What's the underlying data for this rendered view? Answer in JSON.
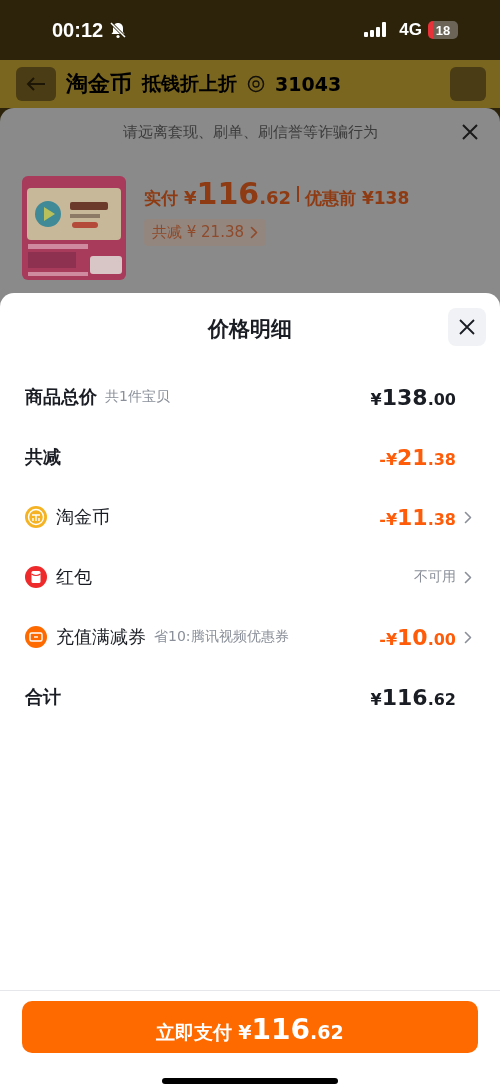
{
  "status_bar": {
    "time": "00:12",
    "network": "4G",
    "battery": "18"
  },
  "backdrop": {
    "header": {
      "title": "淘金币",
      "subtitle": "抵钱折上折",
      "coins": "31043"
    },
    "notice": "请远离套现、刷单、刷信誉等诈骗行为",
    "product": {
      "kind": "picture",
      "paid_label": "实付",
      "paid_price": "¥116.62",
      "original_price": "优惠前 ¥138",
      "discount_chip": "共减 ¥ 21.38"
    }
  },
  "sheet": {
    "title": "价格明细",
    "rows": [
      {
        "kind": "subtotal",
        "label": "商品总价",
        "note": "共1件宝贝",
        "value": "¥138.00"
      },
      {
        "kind": "deduction",
        "label": "共减",
        "value": "-¥21.38"
      },
      {
        "kind": "coins",
        "label": "淘金币",
        "value": "-¥11.38"
      },
      {
        "kind": "packet",
        "label": "红包",
        "value": "不可用"
      },
      {
        "kind": "coupon",
        "label": "充值满减券",
        "note": "省10:腾讯视频优惠券",
        "value": "-¥10.00"
      },
      {
        "kind": "total",
        "label": "合计",
        "value": "¥116.62"
      }
    ],
    "pay_button": {
      "label": "立即支付",
      "amount": "¥116.62"
    }
  }
}
